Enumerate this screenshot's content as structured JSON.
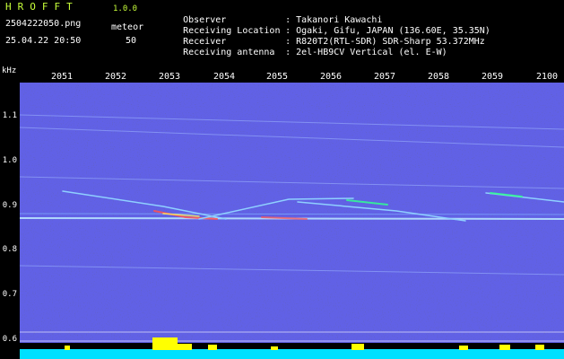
{
  "app": {
    "name": "HROFFT",
    "version": "1.0.0",
    "file_name": "2504222050.png",
    "timestamp": "25.04.22 20:50",
    "mode_label": "meteor",
    "mode_count": "50"
  },
  "meta": [
    {
      "label": "Observer",
      "value": "Takanori Kawachi"
    },
    {
      "label": "Receiving Location",
      "value": "Ogaki, Gifu, JAPAN (136.60E, 35.35N)"
    },
    {
      "label": "Receiver",
      "value": "R820T2(RTL-SDR) SDR-Sharp 53.372MHz"
    },
    {
      "label": "Receiving antenna",
      "value": "2el-HB9CV Vertical (el. E-W)"
    }
  ],
  "axis": {
    "y_unit": "kHz",
    "y_ticks": [
      "1.1",
      "1.0",
      "0.9",
      "0.8",
      "0.7",
      "0.6"
    ],
    "x_ticks": [
      "2051",
      "2052",
      "2053",
      "2054",
      "2055",
      "2056",
      "2057",
      "2058",
      "2059",
      "2100"
    ]
  },
  "colors": {
    "background": "#000000",
    "noise": "#1a1aa0",
    "signal": "#8fd0ff",
    "echo_hot": "#ff4040",
    "bottom_bar": "#00e0ff",
    "bottom_peak": "#ffff00",
    "header_accent": "#c8ff3a"
  }
}
